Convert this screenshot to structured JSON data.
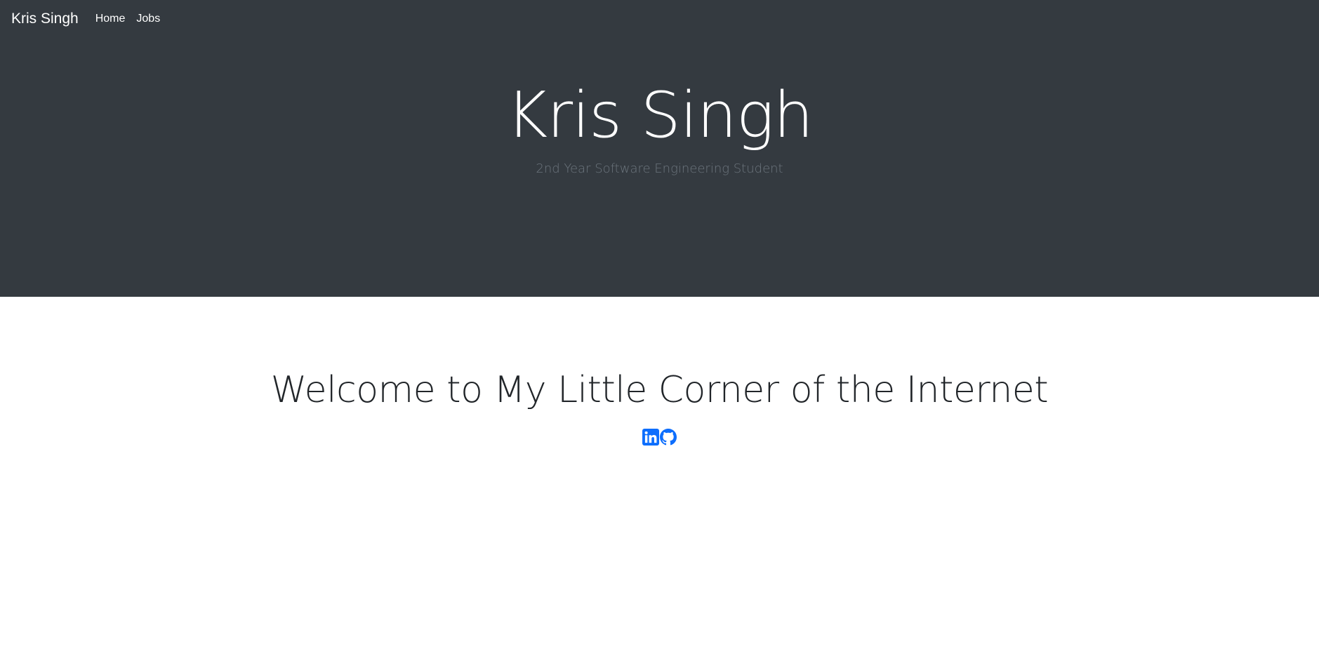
{
  "navbar": {
    "brand": "Kris Singh",
    "links": [
      {
        "label": "Home"
      },
      {
        "label": "Jobs"
      }
    ]
  },
  "hero": {
    "title": "Kris Singh",
    "subtitle": "2nd Year Software Engineering Student"
  },
  "main": {
    "heading": "Welcome to My Little Corner of the Internet",
    "socials": [
      {
        "icon": "linkedin-icon"
      },
      {
        "icon": "github-icon"
      }
    ]
  },
  "colors": {
    "hero_background": "#343a40",
    "subtitle": "#6c757d",
    "heading": "#212529",
    "social_icon": "#0d6efd"
  }
}
